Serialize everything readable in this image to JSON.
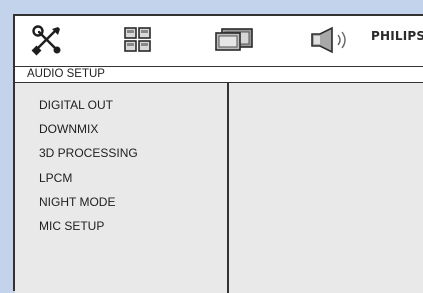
{
  "toolbar": {
    "icons": [
      "tools-icon",
      "grid-icon",
      "tv-icon",
      "speaker-icon"
    ],
    "brand": "PHILIPS"
  },
  "setup": {
    "title": "AUDIO SETUP",
    "items": [
      "DIGITAL OUT",
      "DOWNMIX",
      "3D PROCESSING",
      "LPCM",
      "NIGHT MODE",
      "MIC SETUP"
    ]
  },
  "colors": {
    "background": "#c4d3ec",
    "panel": "#e9e9e9",
    "frame": "#333333"
  }
}
